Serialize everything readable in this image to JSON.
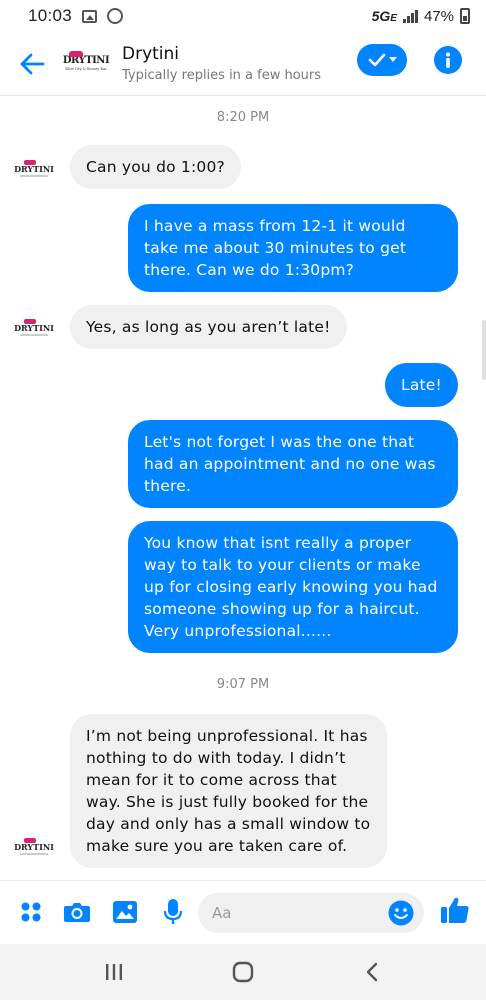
{
  "status_bar": {
    "time": "10:03",
    "network": "5G",
    "network_suffix": "E",
    "battery": "47%"
  },
  "header": {
    "contact_name": "Drytini",
    "subtitle": "Typically replies in a few hours",
    "logo_text": "DRYTINI",
    "logo_tagline": "Blow Dry & Beauty Bar"
  },
  "thread": {
    "timestamps": [
      "8:20 PM",
      "9:07 PM"
    ],
    "messages": [
      {
        "from": "them",
        "text": "Can you do 1:00?"
      },
      {
        "from": "me",
        "text": "I have a mass from 12-1 it would take me about 30 minutes to get there. Can we do 1:30pm?"
      },
      {
        "from": "them",
        "text": "Yes, as long as you aren’t late!"
      },
      {
        "from": "me",
        "text": "Late!"
      },
      {
        "from": "me",
        "text": "Let's not forget I was the one that had an appointment and no one was there."
      },
      {
        "from": "me",
        "text": "You know that isnt really a proper way to talk to your clients or make up for closing early knowing you had someone showing up for a haircut. Very unprofessional......"
      },
      {
        "from": "them",
        "text": "I’m not being unprofessional.  It has nothing to do with today.  I didn’t mean for it to come across that way. She is just fully booked for the day and only has a small window to make sure you are taken care of."
      }
    ]
  },
  "composer": {
    "placeholder": "Aa"
  },
  "colors": {
    "accent": "#0084ff",
    "incoming_bubble": "#f1f0f0",
    "brand_pink": "#d6246e"
  },
  "icons": [
    "back-arrow-icon",
    "checkmark-icon",
    "info-icon",
    "apps-grid-icon",
    "camera-icon",
    "gallery-icon",
    "microphone-icon",
    "emoji-icon",
    "thumbs-up-icon",
    "recents-icon",
    "home-icon",
    "back-nav-icon"
  ]
}
